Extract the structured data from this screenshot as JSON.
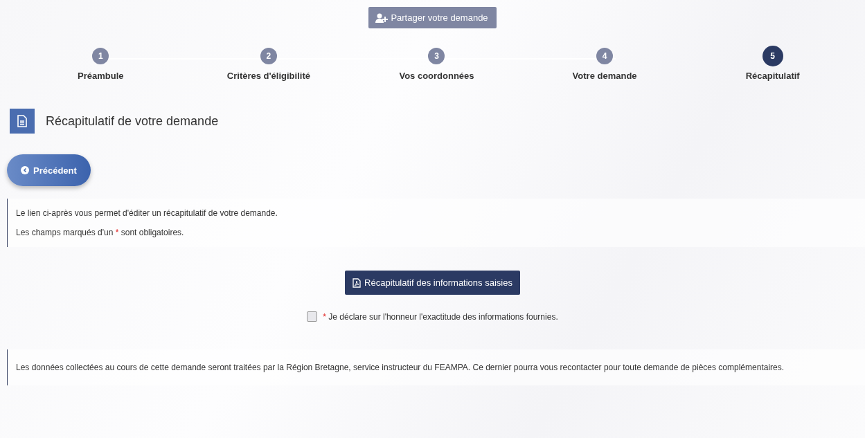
{
  "share_button": {
    "label": "Partager votre demande"
  },
  "steps": [
    {
      "number": "1",
      "label": "Préambule",
      "selected": false
    },
    {
      "number": "2",
      "label": "Critères d'éligibilité",
      "selected": false
    },
    {
      "number": "3",
      "label": "Vos coordonnées",
      "selected": false
    },
    {
      "number": "4",
      "label": "Votre demande",
      "selected": false
    },
    {
      "number": "5",
      "label": "Récapitulatif",
      "selected": true
    }
  ],
  "section_title": "Récapitulatif de votre demande",
  "previous_button": {
    "label": "Précédent"
  },
  "info_box": {
    "line_1": "Le lien ci-après vous permet d'éditer un récapitulatif de votre demande.",
    "line_2_before": "Les champs marqués d'un",
    "required_mark": "*",
    "line_2_after": "sont obligatoires."
  },
  "summary_button": {
    "label": "Récapitulatif des informations saisies"
  },
  "declaration": {
    "checked": false,
    "required_mark": "*",
    "label": "Je déclare sur l'honneur l'exactitude des informations fournies."
  },
  "notice": "Les données collectées au cours de cette demande seront traitées par la Région Bretagne, service instructeur du FEAMPA. Ce dernier pourra vous recontacter pour toute demande de pièces complémentaires."
}
